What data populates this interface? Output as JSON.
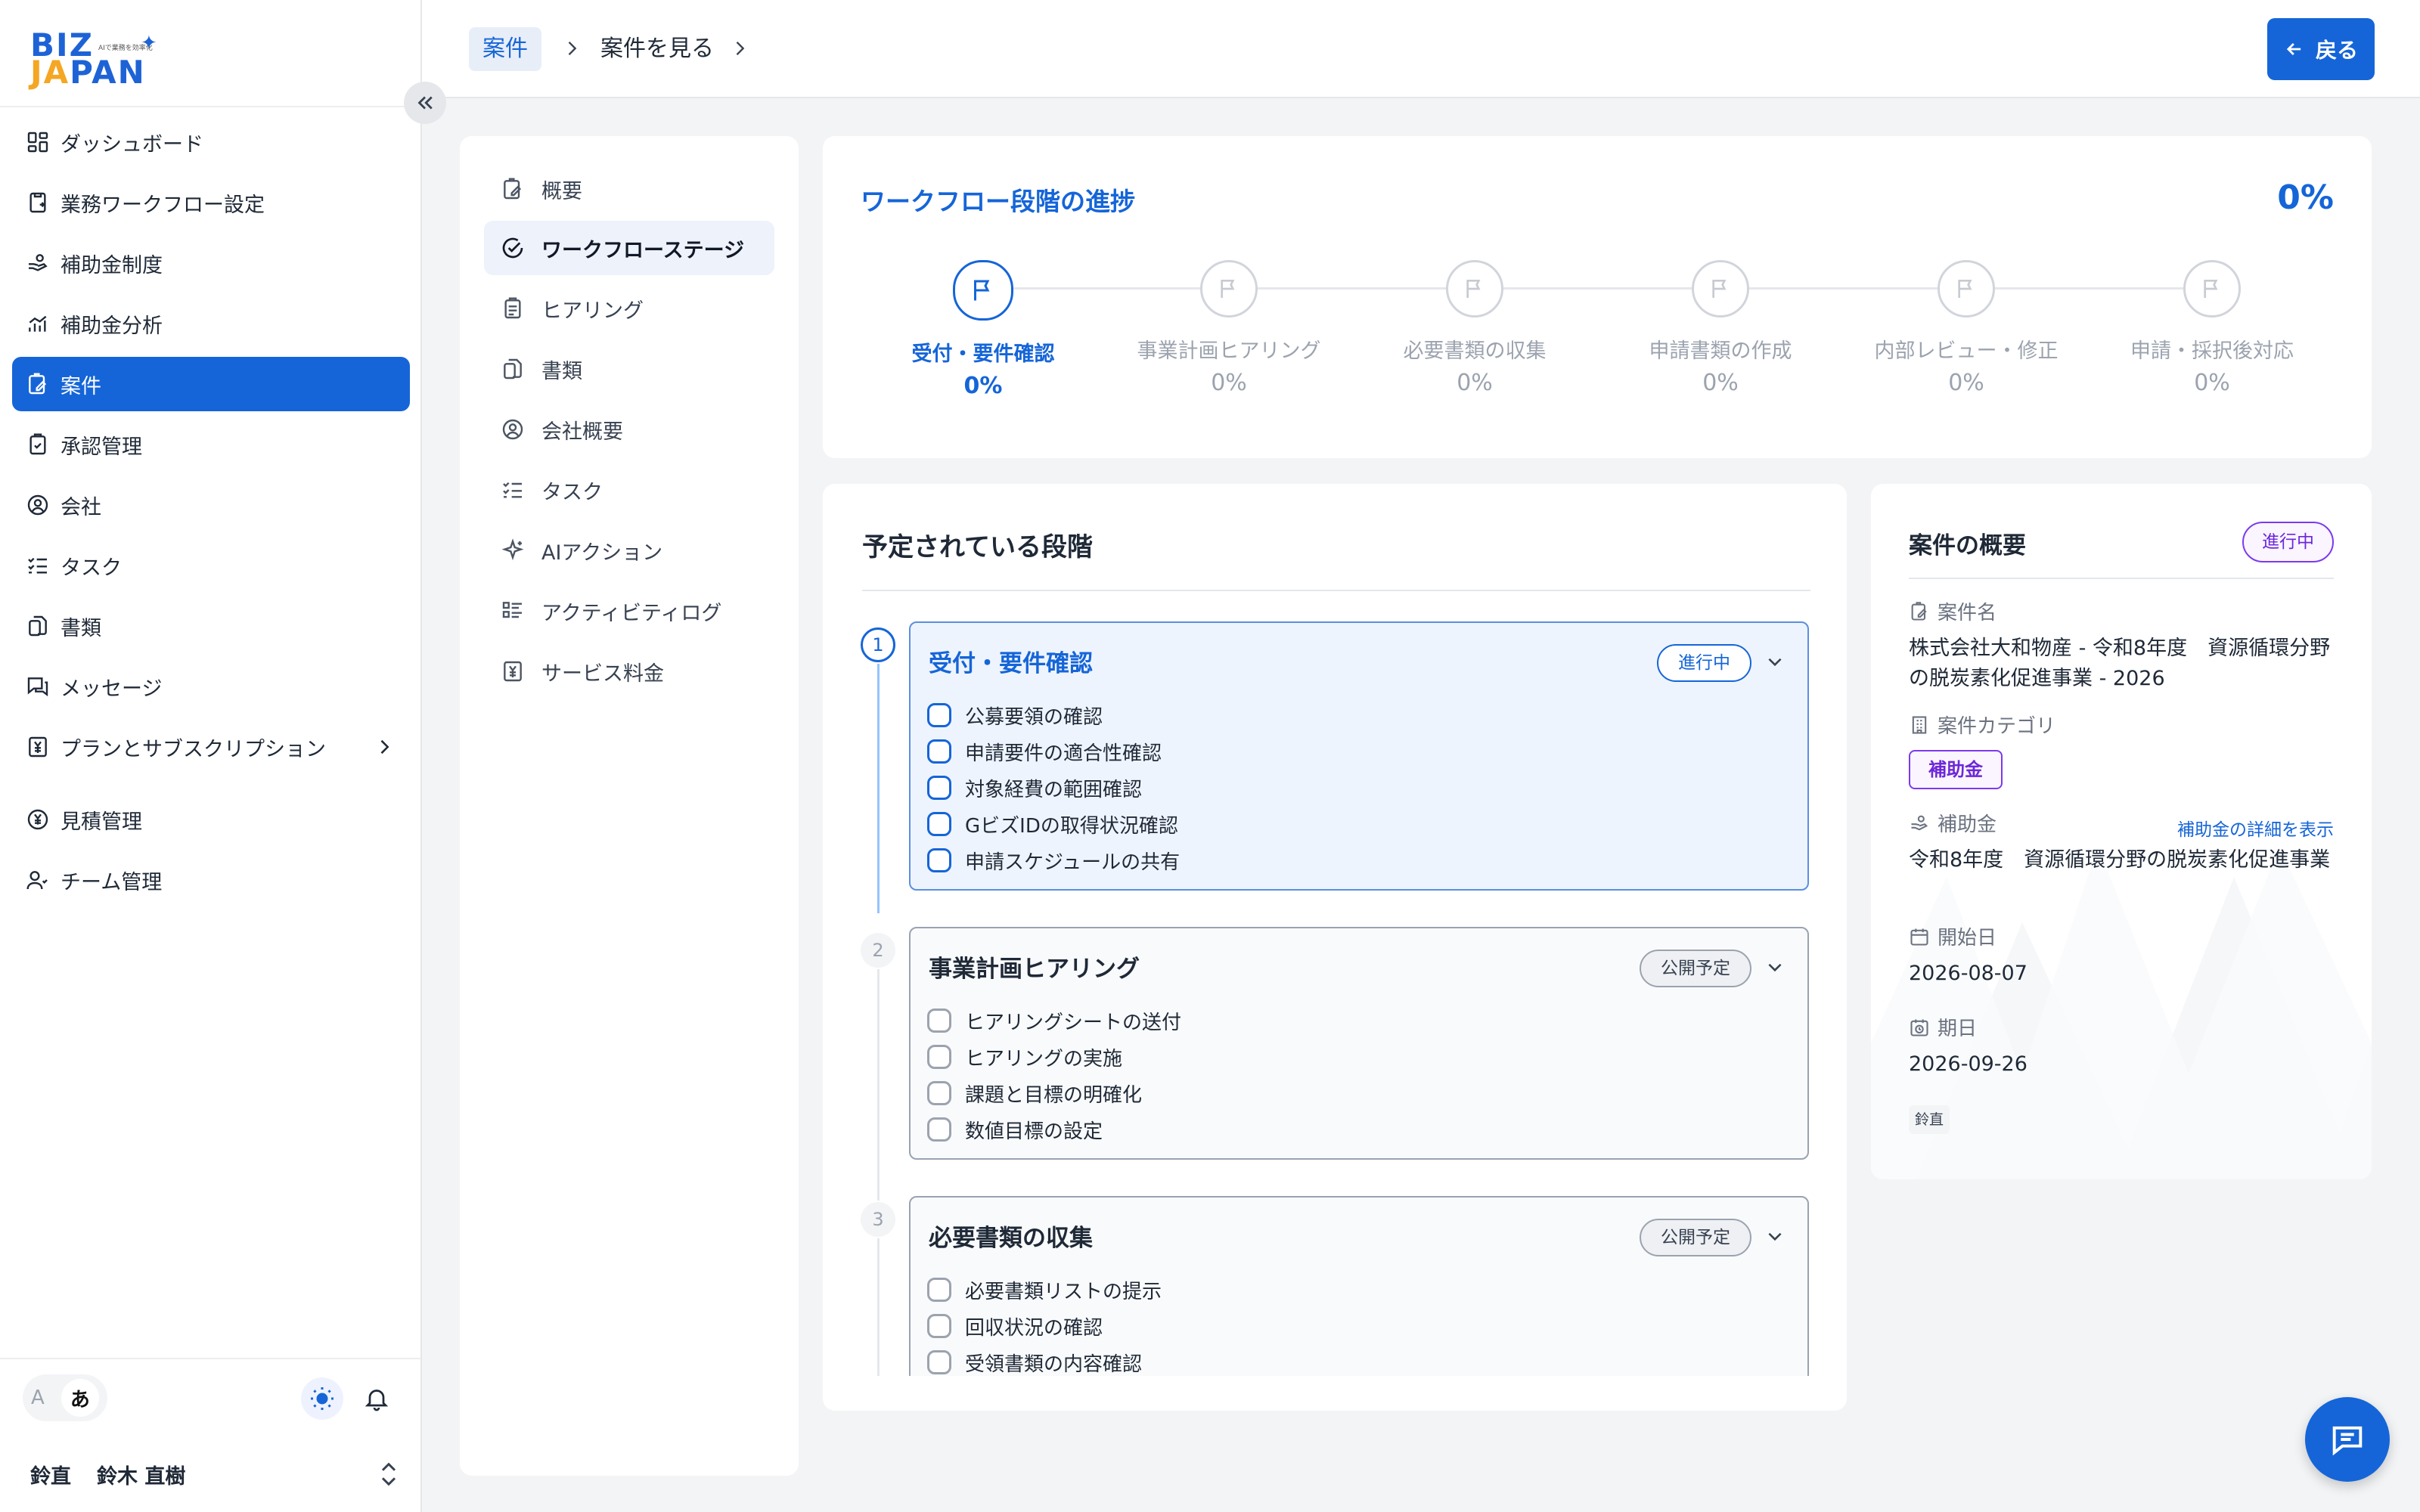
{
  "logo": {
    "line1": "BIZ",
    "line2_a": "JA",
    "line2_b": "PAN",
    "tagline": "AIで業務を効率化"
  },
  "sidebar": {
    "items": [
      {
        "label": "ダッシュボード",
        "icon": "dashboard-icon"
      },
      {
        "label": "業務ワークフロー設定",
        "icon": "workflow-icon"
      },
      {
        "label": "補助金制度",
        "icon": "subsidy-icon"
      },
      {
        "label": "補助金分析",
        "icon": "chart-icon"
      },
      {
        "label": "案件",
        "icon": "case-icon",
        "active": true
      },
      {
        "label": "承認管理",
        "icon": "approval-icon"
      },
      {
        "label": "会社",
        "icon": "company-icon"
      },
      {
        "label": "タスク",
        "icon": "task-icon"
      },
      {
        "label": "書類",
        "icon": "document-icon"
      },
      {
        "label": "メッセージ",
        "icon": "message-icon"
      },
      {
        "label": "プランとサブスクリプション",
        "icon": "yen-icon",
        "has_submenu": true
      },
      {
        "label": "見積管理",
        "icon": "estimate-icon"
      },
      {
        "label": "チーム管理",
        "icon": "team-icon"
      }
    ],
    "lang_off": "A",
    "lang_on": "あ",
    "user_avatar": "鈴直",
    "user_name": "鈴木 直樹"
  },
  "breadcrumb": {
    "item1": "案件",
    "item2": "案件を見る"
  },
  "back_button": "戻る",
  "subnav": {
    "items": [
      {
        "label": "概要",
        "icon": "overview-icon"
      },
      {
        "label": "ワークフローステージ",
        "icon": "stage-icon",
        "active": true
      },
      {
        "label": "ヒアリング",
        "icon": "hearing-icon"
      },
      {
        "label": "書類",
        "icon": "document-icon"
      },
      {
        "label": "会社概要",
        "icon": "company-icon"
      },
      {
        "label": "タスク",
        "icon": "task-icon"
      },
      {
        "label": "AIアクション",
        "icon": "ai-sparkle-icon"
      },
      {
        "label": "アクティビティログ",
        "icon": "activity-icon"
      },
      {
        "label": "サービス料金",
        "icon": "fee-icon"
      }
    ]
  },
  "progress": {
    "title": "ワークフロー段階の進捗",
    "percent": "0%",
    "steps": [
      {
        "label": "受付・要件確認",
        "pct": "0%",
        "active": true
      },
      {
        "label": "事業計画ヒアリング",
        "pct": "0%"
      },
      {
        "label": "必要書類の収集",
        "pct": "0%"
      },
      {
        "label": "申請書類の作成",
        "pct": "0%"
      },
      {
        "label": "内部レビュー・修正",
        "pct": "0%"
      },
      {
        "label": "申請・採択後対応",
        "pct": "0%"
      }
    ]
  },
  "planned": {
    "title": "予定されている段階",
    "stages": [
      {
        "num": "1",
        "name": "受付・要件確認",
        "badge": "進行中",
        "active": true,
        "items": [
          "公募要領の確認",
          "申請要件の適合性確認",
          "対象経費の範囲確認",
          "GビズIDの取得状況確認",
          "申請スケジュールの共有"
        ]
      },
      {
        "num": "2",
        "name": "事業計画ヒアリング",
        "badge": "公開予定",
        "items": [
          "ヒアリングシートの送付",
          "ヒアリングの実施",
          "課題と目標の明確化",
          "数値目標の設定"
        ]
      },
      {
        "num": "3",
        "name": "必要書類の収集",
        "badge": "公開予定",
        "items": [
          "必要書類リストの提示",
          "回収状況の確認",
          "受領書類の内容確認"
        ]
      }
    ]
  },
  "summary": {
    "title": "案件の概要",
    "status": "進行中",
    "case_name_label": "案件名",
    "case_name": "株式会社大和物産 - 令和8年度　資源循環分野の脱炭素化促進事業 - 2026",
    "category_label": "案件カテゴリ",
    "category": "補助金",
    "subsidy_label": "補助金",
    "subsidy_link": "補助金の詳細を表示",
    "subsidy": "令和8年度　資源循環分野の脱炭素化促進事業",
    "start_label": "開始日",
    "start_date": "2026-08-07",
    "due_label": "期日",
    "due_date": "2026-09-26",
    "owner": "鈴直"
  },
  "colors": {
    "primary": "#1565d8",
    "purple": "#7c3aed"
  }
}
